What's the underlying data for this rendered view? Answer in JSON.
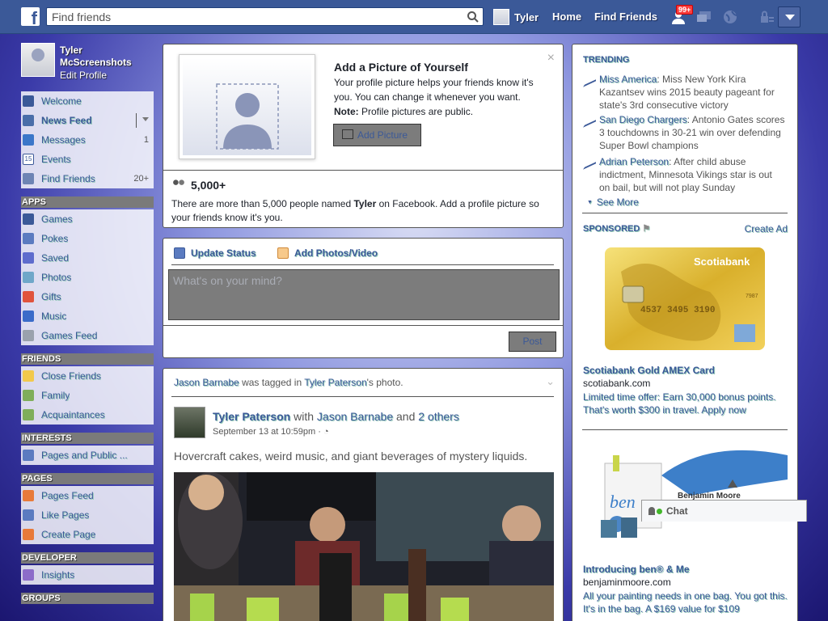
{
  "topbar": {
    "logo": "f",
    "search_placeholder": "Find friends",
    "user_name": "Tyler",
    "home": "Home",
    "find_friends": "Find Friends",
    "notification_badge": "99+"
  },
  "profile": {
    "name": "Tyler McScreenshots",
    "edit": "Edit Profile"
  },
  "sidebar": {
    "favorites": [
      {
        "label": "Welcome",
        "count": ""
      },
      {
        "label": "News Feed",
        "count": ""
      },
      {
        "label": "Messages",
        "count": "1"
      },
      {
        "label": "Events",
        "count": ""
      },
      {
        "label": "Find Friends",
        "count": "20+"
      }
    ],
    "apps_header": "APPS",
    "apps": [
      "Games",
      "Pokes",
      "Saved",
      "Photos",
      "Gifts",
      "Music",
      "Games Feed"
    ],
    "friends_header": "FRIENDS",
    "friends": [
      "Close Friends",
      "Family",
      "Acquaintances"
    ],
    "interests_header": "INTERESTS",
    "interests": [
      "Pages and Public ..."
    ],
    "pages_header": "PAGES",
    "pages": [
      "Pages Feed",
      "Like Pages",
      "Create Page"
    ],
    "developer_header": "DEVELOPER",
    "developer": [
      "Insights"
    ],
    "groups_header": "GROUPS"
  },
  "profile_prompt": {
    "title": "Add a Picture of Yourself",
    "desc": "Your profile picture helps your friends know it's you. You can change it whenever you want.",
    "note_label": "Note:",
    "note": " Profile pictures are public.",
    "button": "Add Picture",
    "close": "×",
    "count": "5,000+",
    "message_pre": "There are more than 5,000 people named ",
    "message_name": "Tyler",
    "message_post": " on Facebook. Add a profile picture so your friends know it's you."
  },
  "status": {
    "tab_update": "Update Status",
    "tab_photos": "Add Photos/Video",
    "placeholder": "What's on your mind?",
    "post": "Post"
  },
  "story": {
    "header_actor": "Jason Barnabe",
    "header_mid": " was tagged in ",
    "header_owner": "Tyler Paterson",
    "header_post": "'s photo.",
    "author": "Tyler Paterson",
    "with": " with ",
    "tagged": "Jason Barnabe",
    "and": " and ",
    "others": "2 others",
    "time": "September 13 at 10:59pm · ",
    "text": "Hovercraft cakes, weird music, and giant beverages of mystery liquids."
  },
  "trending": {
    "title": "TRENDING",
    "items": [
      {
        "topic": "Miss America",
        "text": ": Miss New York Kira Kazantsev wins 2015 beauty pageant for state's 3rd consecutive victory"
      },
      {
        "topic": "San Diego Chargers",
        "text": ": Antonio Gates scores 3 touchdowns in 30-21 win over defending Super Bowl champions"
      },
      {
        "topic": "Adrian Peterson",
        "text": ": After child abuse indictment, Minnesota Vikings star is out on bail, but will not play Sunday"
      }
    ],
    "see_more": "See More"
  },
  "sponsored": {
    "title": "SPONSORED",
    "create_ad": "Create Ad",
    "ads": [
      {
        "title": "Scotiabank Gold AMEX Card",
        "url": "scotiabank.com",
        "desc": "Limited time offer: Earn 30,000 bonus points. That's worth $300 in travel. Apply now",
        "card_brand": "Scotiabank",
        "card_number": "4537 3495 3190",
        "card_expiry": "7987"
      },
      {
        "title": "Introducing ben® & Me",
        "url": "benjaminmoore.com",
        "desc": "All your painting needs in one bag. You got this. It's in the bag. A $169 value for $109",
        "image_text": "ben",
        "brand": "Benjamin Moore"
      }
    ]
  },
  "chat": {
    "label": "Chat"
  },
  "colors": {
    "brand": "#3b5998",
    "accent": "#fa3e3e",
    "online": "#42b72a"
  }
}
